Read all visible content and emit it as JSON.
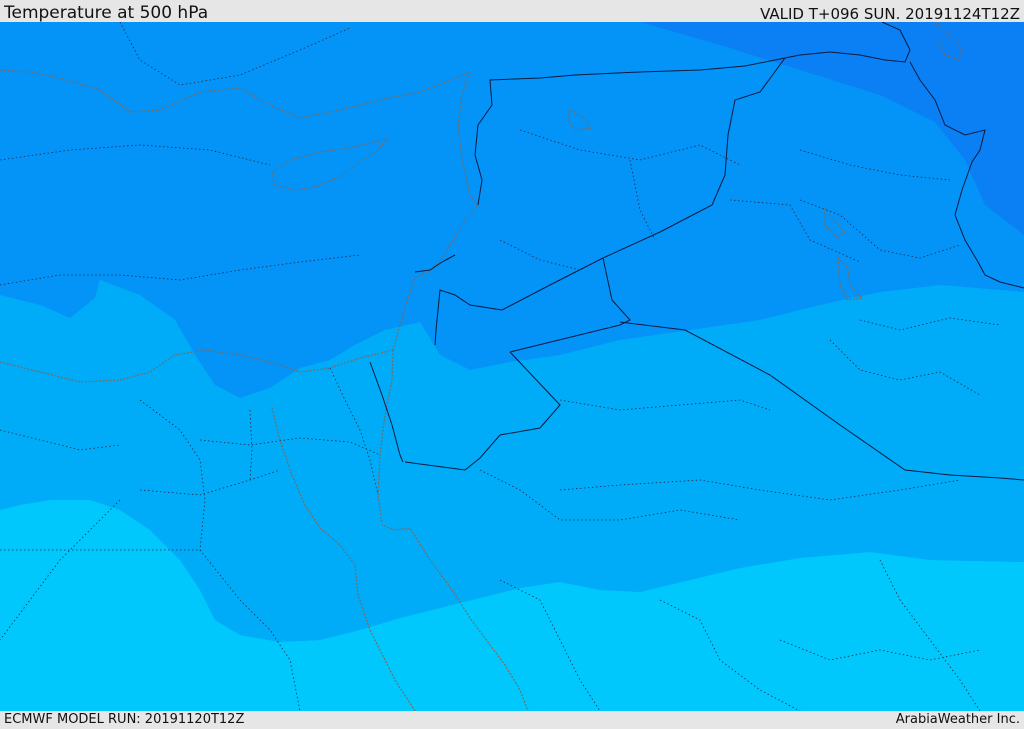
{
  "header": {
    "title": "Temperature at 500 hPa",
    "valid": "VALID T+096 SUN. 20191124T12Z"
  },
  "footer": {
    "model_run": "ECMWF MODEL RUN: 20191120T12Z",
    "credit": "ArabiaWeather Inc."
  },
  "map": {
    "field": "Temperature at 500 hPa",
    "band_colors": [
      "#0a80f4",
      "#0494f8",
      "#00acf8",
      "#00c8fc"
    ],
    "border_color": "#0a1a40",
    "coastline_color": "#7a6a60"
  }
}
